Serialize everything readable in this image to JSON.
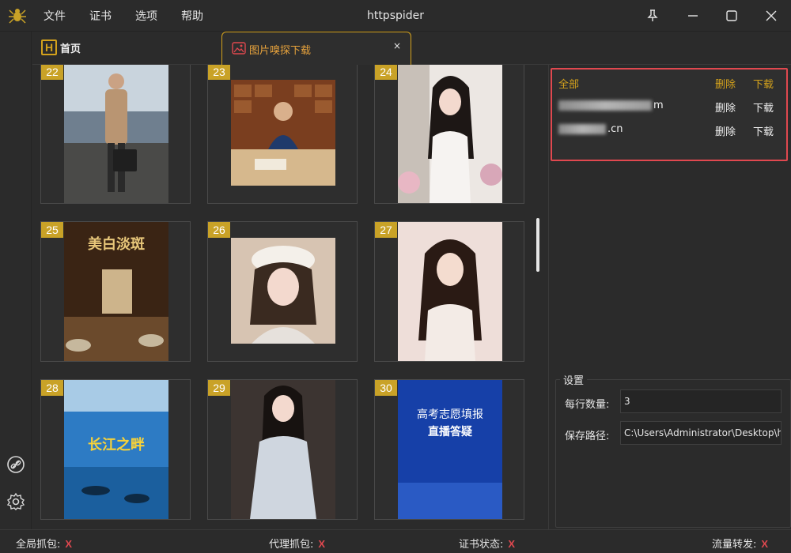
{
  "window": {
    "title": "httpspider",
    "menu": [
      "文件",
      "证书",
      "选项",
      "帮助"
    ]
  },
  "tabs": {
    "home_badge": "H",
    "home_label": "首页",
    "active_label": "图片嗅探下载",
    "close_glyph": "×"
  },
  "images": [
    {
      "num": "22",
      "desc": "man in beige coat"
    },
    {
      "num": "23",
      "desc": "woman at herbal pharmacy desk"
    },
    {
      "num": "24",
      "desc": "girl in white dress"
    },
    {
      "num": "25",
      "desc": "herbal product box"
    },
    {
      "num": "26",
      "desc": "girl with white beret"
    },
    {
      "num": "27",
      "desc": "girl in white slip dress"
    },
    {
      "num": "28",
      "desc": "divers poster"
    },
    {
      "num": "29",
      "desc": "girl in lace dress"
    },
    {
      "num": "30",
      "desc": "blue exam poster"
    }
  ],
  "poster25_text": "美白淡斑",
  "poster28_text": "长江之畔",
  "poster30": {
    "line1": "高考志愿填报",
    "line2": "直播答疑"
  },
  "sites": {
    "header": {
      "name": "全部",
      "delete": "删除",
      "download": "下载"
    },
    "rows": [
      {
        "name_suffix": "m",
        "delete": "删除",
        "download": "下载"
      },
      {
        "name_suffix": ".cn",
        "delete": "删除",
        "download": "下载"
      }
    ]
  },
  "settings": {
    "title": "设置",
    "per_row_label": "每行数量:",
    "per_row_value": "3",
    "save_path_label": "保存路径:",
    "save_path_value": "C:\\Users\\Administrator\\Desktop\\h"
  },
  "status": {
    "global_capture": "全局抓包:",
    "proxy_capture": "代理抓包:",
    "cert_status": "证书状态:",
    "traffic_forward": "流量转发:",
    "off_mark": "X"
  },
  "colors": {
    "accent": "#d4a21c",
    "error": "#e0484f",
    "badge": "#c9a227"
  }
}
